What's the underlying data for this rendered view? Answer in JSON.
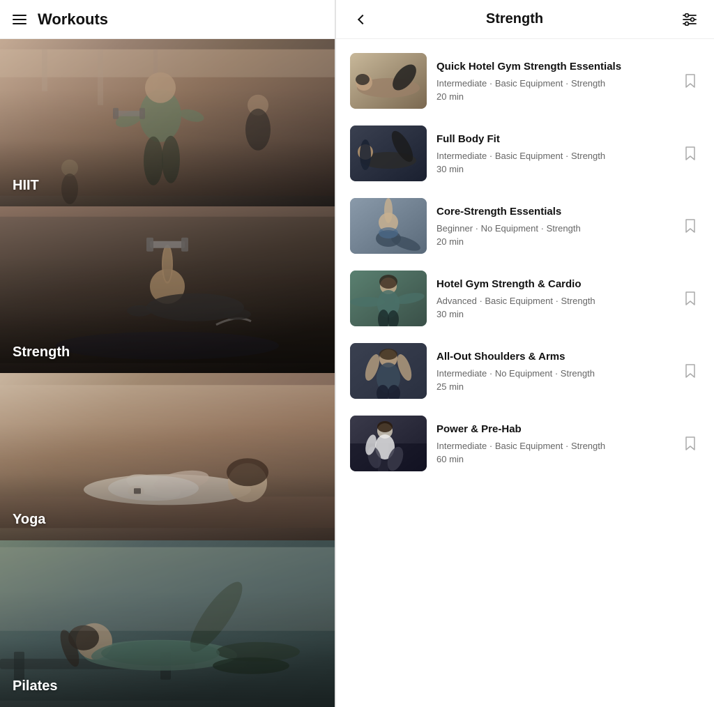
{
  "left": {
    "header": {
      "title": "Workouts",
      "menu_label": "menu"
    },
    "categories": [
      {
        "id": "hiit",
        "label": "HIIT",
        "colorClass": "card-hiit hiit-bg"
      },
      {
        "id": "strength",
        "label": "Strength",
        "colorClass": "card-strength strength-bg"
      },
      {
        "id": "yoga",
        "label": "Yoga",
        "colorClass": "card-yoga yoga-bg"
      },
      {
        "id": "pilates",
        "label": "Pilates",
        "colorClass": "card-pilates pilates-bg"
      }
    ]
  },
  "right": {
    "header": {
      "title": "Strength",
      "back_label": "back",
      "filter_label": "filter"
    },
    "workouts": [
      {
        "id": 1,
        "title": "Quick Hotel Gym Strength Essentials",
        "level": "Intermediate",
        "equipment": "Basic Equipment",
        "type": "Strength",
        "duration": "20 min",
        "thumbClass": "thumb-1"
      },
      {
        "id": 2,
        "title": "Full Body Fit",
        "level": "Intermediate",
        "equipment": "Basic Equipment",
        "type": "Strength",
        "duration": "30 min",
        "thumbClass": "thumb-2"
      },
      {
        "id": 3,
        "title": "Core-Strength Essentials",
        "level": "Beginner",
        "equipment": "No Equipment",
        "type": "Strength",
        "duration": "20 min",
        "thumbClass": "thumb-3"
      },
      {
        "id": 4,
        "title": "Hotel Gym Strength & Cardio",
        "level": "Advanced",
        "equipment": "Basic Equipment",
        "type": "Strength",
        "duration": "30 min",
        "thumbClass": "thumb-4"
      },
      {
        "id": 5,
        "title": "All-Out Shoulders & Arms",
        "level": "Intermediate",
        "equipment": "No Equipment",
        "type": "Strength",
        "duration": "25 min",
        "thumbClass": "thumb-5"
      },
      {
        "id": 6,
        "title": "Power & Pre-Hab",
        "level": "Intermediate",
        "equipment": "Basic Equipment",
        "type": "Strength",
        "duration": "60 min",
        "thumbClass": "thumb-6"
      }
    ]
  }
}
